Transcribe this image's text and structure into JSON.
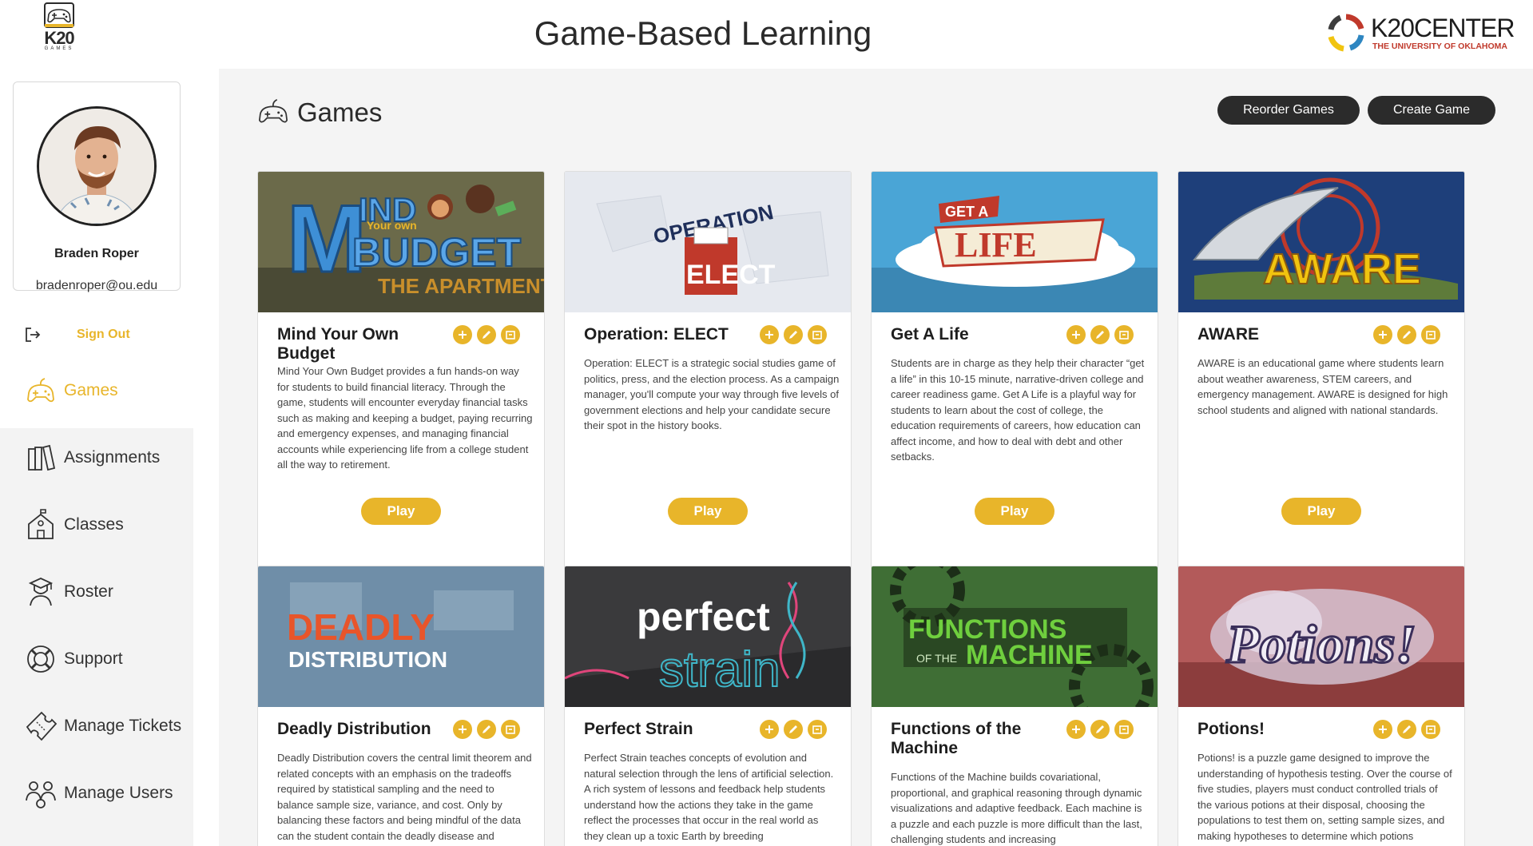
{
  "header": {
    "title": "Game-Based Learning",
    "logo_text": "K20",
    "logo_subtext": "GAMES",
    "partner_logo_text": "K20CENTER",
    "partner_logo_subtext": "THE UNIVERSITY OF OKLAHOMA"
  },
  "user": {
    "name": "Braden Roper",
    "email": "bradenroper@ou.edu"
  },
  "sidebar": {
    "signout_label": "Sign Out",
    "items": [
      {
        "label": "Games",
        "icon": "gamepad-icon",
        "active": true
      },
      {
        "label": "Assignments",
        "icon": "books-icon",
        "active": false
      },
      {
        "label": "Classes",
        "icon": "schoolhouse-icon",
        "active": false
      },
      {
        "label": "Roster",
        "icon": "graduate-icon",
        "active": false
      },
      {
        "label": "Support",
        "icon": "lifebuoy-icon",
        "active": false
      },
      {
        "label": "Manage Tickets",
        "icon": "ticket-icon",
        "active": false
      },
      {
        "label": "Manage Users",
        "icon": "users-icon",
        "active": false
      }
    ]
  },
  "main": {
    "section_title": "Games",
    "reorder_label": "Reorder Games",
    "create_label": "Create Game",
    "play_label": "Play",
    "games": [
      {
        "title": "Mind Your Own Budget",
        "banner_text": "MIND Your own BUDGET THE APARTMENT",
        "description": "Mind Your Own Budget provides a fun hands-on way for students to build financial literacy. Through the game, students will encounter everyday financial tasks such as making and keeping a budget, paying recurring and emergency expenses, and managing financial accounts while experiencing life from a college student all the way to retirement."
      },
      {
        "title": "Operation: ELECT",
        "banner_text": "OPERATION ELECT",
        "description": "Operation: ELECT is a strategic social studies game of politics, press, and the election process. As a campaign manager, you'll compute your way through five levels of government elections and help your candidate secure their spot in the history books."
      },
      {
        "title": "Get A Life",
        "banner_text": "GET A LIFE",
        "description": "Students are in charge as they help their character “get a life” in this 10-15 minute, narrative-driven college and career readiness game. Get A Life is a playful way for students to learn about the cost of college, the education requirements of careers, how education can affect income, and how to deal with debt and other setbacks."
      },
      {
        "title": "AWARE",
        "banner_text": "AWARE",
        "description": "AWARE is an educational game where students learn about weather awareness, STEM careers, and emergency management. AWARE is designed for high school students and aligned with national standards."
      },
      {
        "title": "Deadly Distribution",
        "banner_text": "DEADLY DISTRIBUTION",
        "description": "Deadly Distribution covers the central limit theorem and related concepts with an emphasis on the tradeoffs required by statistical sampling and the need to balance sample size, variance, and cost. Only by balancing these factors and being mindful of the data can the student contain the deadly disease and"
      },
      {
        "title": "Perfect Strain",
        "banner_text": "perfect strain",
        "description": "Perfect Strain teaches concepts of evolution and natural selection through the lens of artificial selection. A rich system of lessons and feedback help students understand how the actions they take in the game reflect the processes that occur in the real world as they clean up a toxic Earth by breeding"
      },
      {
        "title": "Functions of the Machine",
        "banner_text": "FUNCTIONS OF THE MACHINE",
        "description": "Functions of the Machine builds covariational, proportional, and graphical reasoning through dynamic visualizations and adaptive feedback. Each machine is a puzzle and each puzzle is more difficult than the last, challenging students and increasing"
      },
      {
        "title": "Potions!",
        "banner_text": "Potions!",
        "description": "Potions! is a puzzle game designed to improve the understanding of hypothesis testing. Over the course of five studies, players must conduct controlled trials of the various potions at their disposal, choosing the populations to test them on, setting sample sizes, and making hypotheses to determine which potions"
      }
    ]
  },
  "colors": {
    "accent": "#e8b52a",
    "dark_button": "#2b2b2b",
    "main_bg": "#f4f4f4"
  }
}
